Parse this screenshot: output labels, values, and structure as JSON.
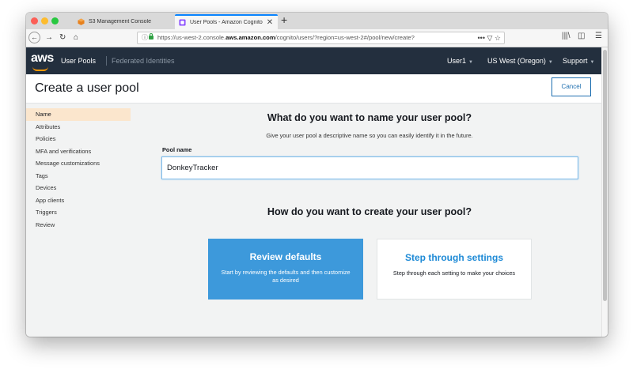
{
  "browser": {
    "tabs": [
      {
        "title": "S3 Management Console",
        "icon": "aws-cube-icon"
      },
      {
        "title": "User Pools - Amazon Cognito",
        "icon": "cognito-icon"
      }
    ],
    "new_tab": "+",
    "close": "✕",
    "url_prefix": "https://us-west-2.console.",
    "url_domain": "aws.amazon.com",
    "url_suffix": "/cognito/users/?region=us-west-2#/pool/new/create?",
    "more_icon": "•••"
  },
  "aws_nav": {
    "logo": "aws",
    "service": "User Pools",
    "federated": "Federated Identities",
    "user": "User1",
    "region": "US West (Oregon)",
    "support": "Support"
  },
  "page": {
    "title": "Create a user pool",
    "cancel": "Cancel"
  },
  "sidebar": {
    "items": [
      {
        "label": "Name",
        "active": true
      },
      {
        "label": "Attributes"
      },
      {
        "label": "Policies"
      },
      {
        "label": "MFA and verifications"
      },
      {
        "label": "Message customizations"
      },
      {
        "label": "Tags"
      },
      {
        "label": "Devices"
      },
      {
        "label": "App clients"
      },
      {
        "label": "Triggers"
      },
      {
        "label": "Review"
      }
    ]
  },
  "main": {
    "name_heading": "What do you want to name your user pool?",
    "name_subtext": "Give your user pool a descriptive name so you can easily identify it in the future.",
    "pool_name_label": "Pool name",
    "pool_name_value": "DonkeyTracker",
    "create_heading": "How do you want to create your user pool?",
    "option1_title": "Review defaults",
    "option1_desc": "Start by reviewing the defaults and then customize as desired",
    "option2_title": "Step through settings",
    "option2_desc": "Step through each setting to make your choices"
  },
  "colors": {
    "aws_header": "#232f3e",
    "aws_orange": "#ff9900",
    "primary_blue": "#3d99db",
    "link_blue": "#1e8ad6",
    "active_nav": "#fbe6cd"
  }
}
